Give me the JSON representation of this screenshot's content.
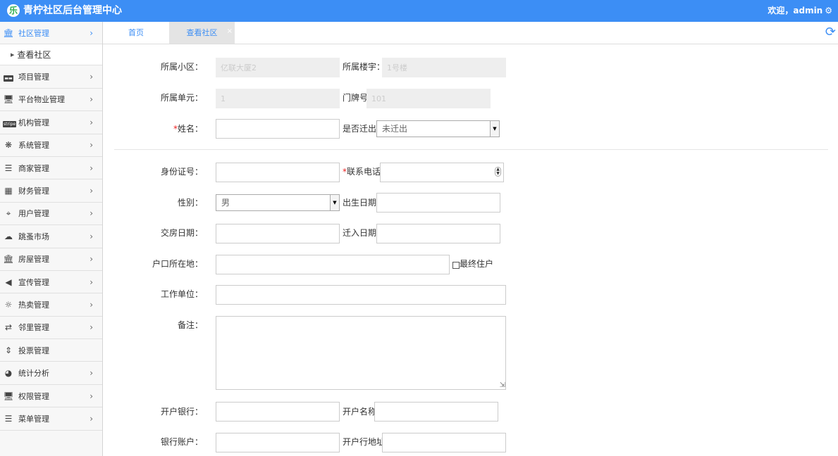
{
  "header": {
    "logo_glyph": "乐",
    "title": "青柠社区后台管理中心",
    "welcome": "欢迎，admin",
    "settings_icon": "gear-icon"
  },
  "sidebar": {
    "items": [
      {
        "label": "社区管理",
        "icon": "bank-icon",
        "active": true
      },
      {
        "label": "项目管理",
        "icon": "card-icon"
      },
      {
        "label": "平台物业管理",
        "icon": "monitor-icon"
      },
      {
        "label": "机构管理",
        "icon": "stripe-icon",
        "badge": "stripe"
      },
      {
        "label": "系统管理",
        "icon": "pinwheel-icon"
      },
      {
        "label": "商家管理",
        "icon": "bars-icon"
      },
      {
        "label": "财务管理",
        "icon": "calculator-icon"
      },
      {
        "label": "用户管理",
        "icon": "crop-icon"
      },
      {
        "label": "跳蚤市场",
        "icon": "cloud-icon"
      },
      {
        "label": "房屋管理",
        "icon": "bank-icon"
      },
      {
        "label": "宣传管理",
        "icon": "volume-icon"
      },
      {
        "label": "热卖管理",
        "icon": "gear-outline-icon"
      },
      {
        "label": "邻里管理",
        "icon": "retweet-icon"
      },
      {
        "label": "投票管理",
        "icon": "sort-icon"
      },
      {
        "label": "统计分析",
        "icon": "pie-chart-icon"
      },
      {
        "label": "权限管理",
        "icon": "monitor-icon"
      },
      {
        "label": "菜单管理",
        "icon": "list-icon"
      }
    ],
    "subitem": "查看社区"
  },
  "tabs": {
    "home": "首页",
    "current": "查看社区",
    "close": "×"
  },
  "form": {
    "community_label": "所属小区：",
    "community_value": "亿联大厦2",
    "building_label": "所属楼宇：",
    "building_value": "1号楼",
    "unit_label": "所属单元：",
    "unit_value": "1",
    "door_label": "门牌号",
    "door_value": "101",
    "name_label": "姓名：",
    "moved_label": "是否迁出",
    "moved_value": "未迁出",
    "idcard_label": "身份证号：",
    "phone_label": "联系电话",
    "gender_label": "性别：",
    "gender_value": "男",
    "birth_label": "出生日期",
    "handover_label": "交房日期：",
    "movein_label": "迁入日期",
    "hukou_label": "户口所在地：",
    "final_label": "最终住户",
    "work_label": "工作单位：",
    "remark_label": "备注：",
    "bank_label": "开户银行：",
    "account_name_label": "开户名称",
    "bank_account_label": "银行账户：",
    "bank_addr_label": "开户行地址",
    "required_mark": "*"
  }
}
